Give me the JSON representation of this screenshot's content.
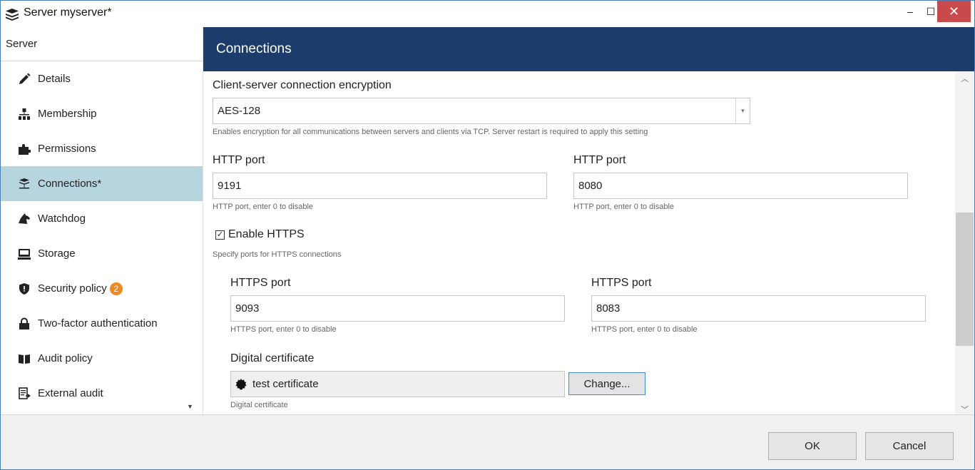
{
  "window": {
    "title": "Server myserver*",
    "minimize": "–",
    "maximize": "☐",
    "close": "✕"
  },
  "sidebar": {
    "header": "Server",
    "items": [
      {
        "label": "Details",
        "icon": "pencil-icon"
      },
      {
        "label": "Membership",
        "icon": "hierarchy-icon"
      },
      {
        "label": "Permissions",
        "icon": "puzzle-icon"
      },
      {
        "label": "Connections*",
        "icon": "server-network-icon"
      },
      {
        "label": "Watchdog",
        "icon": "dog-icon"
      },
      {
        "label": "Storage",
        "icon": "storage-icon"
      },
      {
        "label": "Security policy",
        "icon": "shield-icon",
        "badge": "2"
      },
      {
        "label": "Two-factor authentication",
        "icon": "lock-icon"
      },
      {
        "label": "Audit policy",
        "icon": "book-icon"
      },
      {
        "label": "External audit",
        "icon": "export-doc-icon"
      }
    ],
    "active_index": 3
  },
  "main": {
    "title": "Connections",
    "encryption": {
      "label": "Client-server connection encryption",
      "value": "AES-128",
      "hint": "Enables encryption for all communications between servers and clients via TCP. Server restart is required to apply this setting"
    },
    "http_port_1": {
      "label": "HTTP port",
      "value": "9191",
      "hint": "HTTP port, enter 0 to disable"
    },
    "http_port_2": {
      "label": "HTTP port",
      "value": "8080",
      "hint": "HTTP port, enter 0 to disable"
    },
    "https": {
      "checkbox_label": "Enable HTTPS",
      "checked": true,
      "hint": "Specify ports for HTTPS connections"
    },
    "https_port_1": {
      "label": "HTTPS port",
      "value": "9093",
      "hint": "HTTPS port, enter 0 to disable"
    },
    "https_port_2": {
      "label": "HTTPS port",
      "value": "8083",
      "hint": "HTTPS port, enter 0 to disable"
    },
    "certificate": {
      "label": "Digital certificate",
      "value": "test certificate",
      "hint": "Digital certificate",
      "change_button": "Change..."
    }
  },
  "footer": {
    "ok_label": "OK",
    "cancel_label": "Cancel"
  },
  "colors": {
    "header_bg": "#1c3d6b",
    "active_item_bg": "#b6d5de",
    "badge": "#f08a24",
    "close_button": "#c94a4a"
  }
}
